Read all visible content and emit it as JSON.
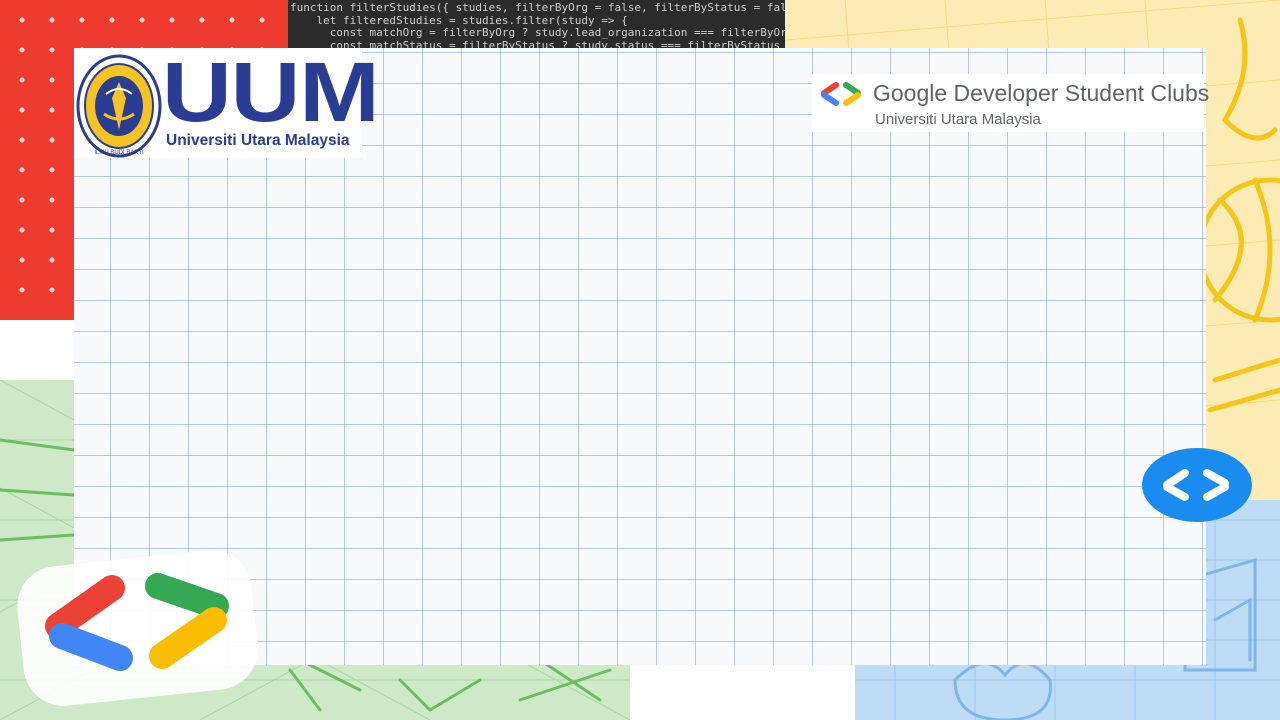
{
  "code_snippet": [
    "function filterStudies({ studies, filterByOrg = false, filterByStatus = false",
    "    let filteredStudies = studies.filter(study => {",
    "      const matchOrg = filterByOrg ? study.lead_organization === filterByOrg",
    "      const matchStatus = filterByStatus ? study.status === filterByStatus :"
  ],
  "uum_logo": {
    "abbrev": "UUM",
    "name": "Universiti Utara Malaysia",
    "seal_text_top": "UNIVERSITI UTARA MALAYSIA",
    "seal_text_bottom": "ILMU BUDI BAKTI"
  },
  "gdsc_logo": {
    "title": "Google Developer Student Clubs",
    "subtitle": "Universiti Utara Malaysia"
  },
  "colors": {
    "red": "#ee3a2f",
    "yellow": "#fdebb5",
    "green": "#cde9c8",
    "blue": "#bfdcf7",
    "uum_blue": "#2b3d93",
    "google_blue": "#4285f4",
    "google_red": "#ea4335",
    "google_yellow": "#fbbc04",
    "google_green": "#34a853",
    "badge_blue": "#1a8cf0"
  },
  "icons": [
    "seal-icon",
    "gdsc-chevrons-icon",
    "code-brackets-icon",
    "gdsc-large-icon"
  ]
}
